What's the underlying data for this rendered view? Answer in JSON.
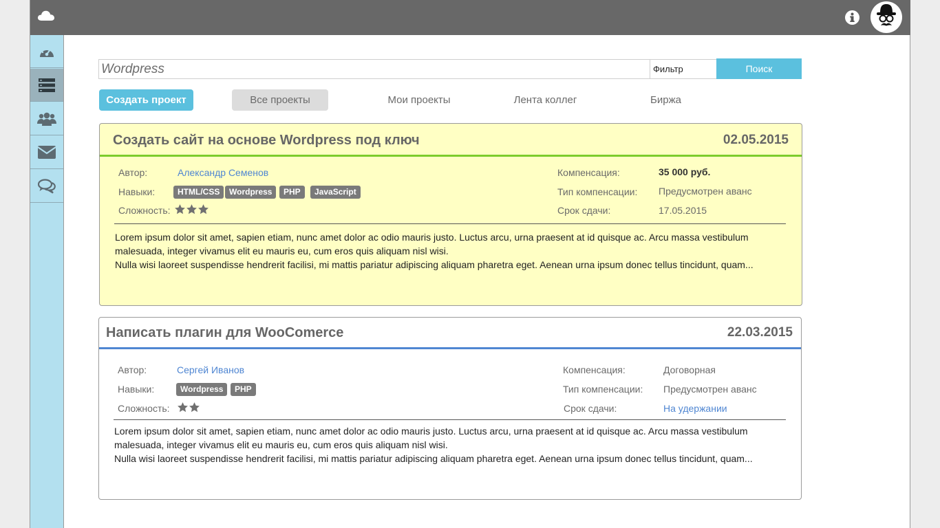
{
  "search": {
    "query": "Wordpress",
    "filter_label": "Фильтр",
    "button_label": "Поиск"
  },
  "tabs": {
    "create": "Создать проект",
    "all": "Все проекты",
    "mine": "Мои проекты",
    "colleagues": "Лента коллег",
    "exchange": "Биржа"
  },
  "labels": {
    "author": "Автор:",
    "skills": "Навыки:",
    "complexity": "Сложность:",
    "compensation": "Компенсация:",
    "compensation_type": "Тип компенсации:",
    "deadline": "Срок сдачи:"
  },
  "projects": [
    {
      "title": "Создать сайт на основе Wordpress под ключ",
      "date": "02.05.2015",
      "author": "Александр Семенов",
      "skills": [
        "HTML/CSS",
        "Wordpress",
        "PHP",
        "JavaScript"
      ],
      "complexity_stars": 3,
      "compensation": "35 000 руб.",
      "compensation_type": "Предусмотрен аванс",
      "deadline": "17.05.2015",
      "description_1": "Lorem ipsum dolor sit amet, sapien etiam, nunc amet dolor ac odio mauris justo. Luctus arcu, urna praesent at id quisque ac. Arcu massa vestibulum malesuada, integer vivamus elit eu mauris eu, cum eros quis aliquam nisl wisi.",
      "description_2": "Nulla wisi laoreet suspendisse hendrerit facilisi, mi mattis pariatur adipiscing aliquam pharetra eget. Aenean urna ipsum donec tellus tincidunt, quam..."
    },
    {
      "title": "Написать плагин для WooComerce",
      "date": "22.03.2015",
      "author": "Сергей Иванов",
      "skills": [
        "Wordpress",
        "PHP"
      ],
      "complexity_stars": 2,
      "compensation": "Договорная",
      "compensation_type": "Предусмотрен аванс",
      "deadline": "На удержании",
      "description_1": "Lorem ipsum dolor sit amet, sapien etiam, nunc amet dolor ac odio mauris justo. Luctus arcu, urna praesent at id quisque ac. Arcu massa vestibulum malesuada, integer vivamus elit eu mauris eu, cum eros quis aliquam nisl wisi.",
      "description_2": "Nulla wisi laoreet suspendisse hendrerit facilisi, mi mattis pariatur adipiscing aliquam pharetra eget. Aenean urna ipsum donec tellus tincidunt, quam..."
    }
  ],
  "icons": {
    "logo": "cloud-icon",
    "info": "info-icon",
    "avatar": "hat-mustache-avatar",
    "sidebar": [
      "dashboard-gauge-icon",
      "projects-list-icon",
      "users-group-icon",
      "mail-icon",
      "chat-icon"
    ]
  },
  "colors": {
    "topbar": "#686868",
    "sidebar": "#b3e0ef",
    "accent": "#5bc0de",
    "card_highlight": "#ffffc4",
    "card_highlight_border": "#7ccc2d",
    "card_border": "#4f86d2",
    "link": "#4f86d2"
  }
}
